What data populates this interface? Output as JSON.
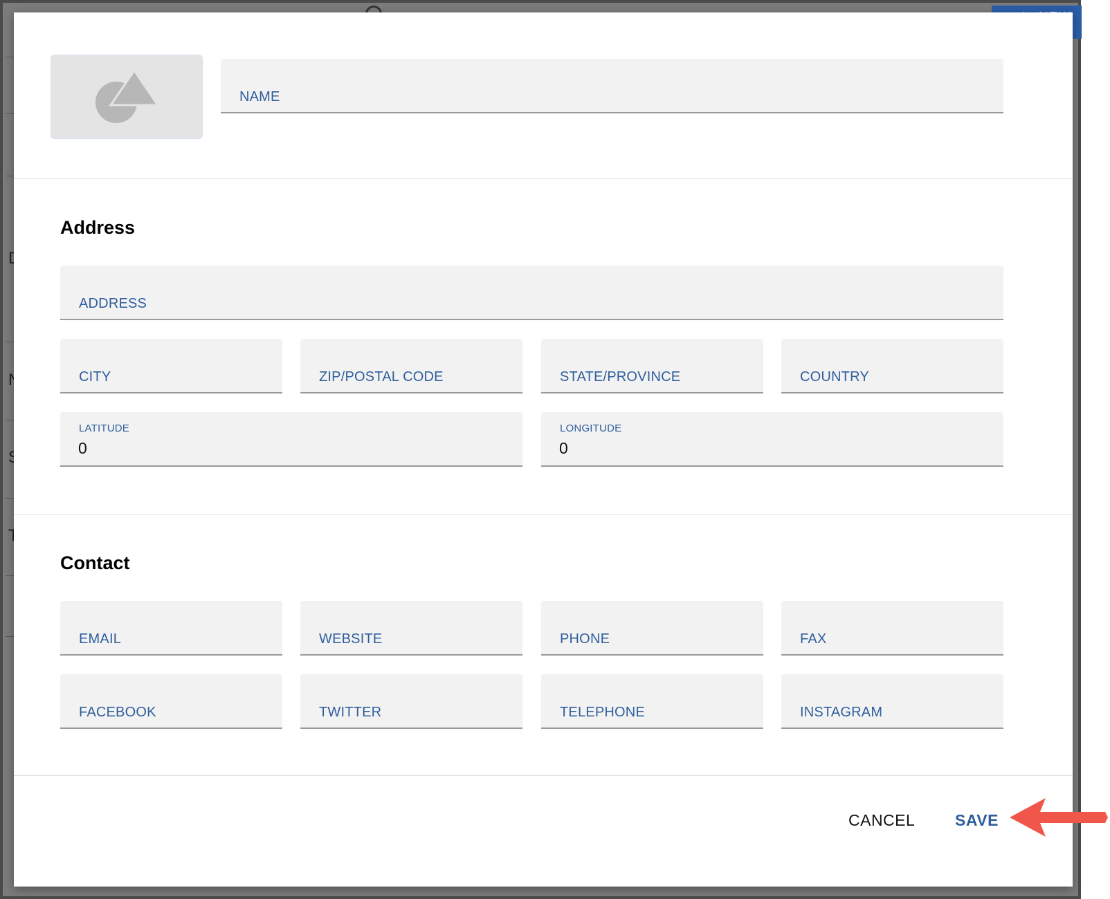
{
  "background": {
    "new_button_label": "NEW",
    "row_letters": [
      "D",
      "N",
      "S",
      "T"
    ]
  },
  "form": {
    "name_label": "NAME",
    "address_section": {
      "title": "Address",
      "address_label": "ADDRESS",
      "city_label": "CITY",
      "zip_label": "ZIP/POSTAL CODE",
      "state_label": "STATE/PROVINCE",
      "country_label": "COUNTRY",
      "latitude_label": "LATITUDE",
      "latitude_value": "0",
      "longitude_label": "LONGITUDE",
      "longitude_value": "0"
    },
    "contact_section": {
      "title": "Contact",
      "email_label": "EMAIL",
      "website_label": "WEBSITE",
      "phone_label": "PHONE",
      "fax_label": "FAX",
      "facebook_label": "FACEBOOK",
      "twitter_label": "TWITTER",
      "telephone_label": "TELEPHONE",
      "instagram_label": "INSTAGRAM"
    }
  },
  "actions": {
    "cancel_label": "CANCEL",
    "save_label": "SAVE"
  },
  "colors": {
    "accent": "#2f5e9c",
    "field_bg": "#f2f2f2",
    "annotation_arrow": "#f0574a"
  },
  "icons": {
    "image_placeholder": "shapes-icon",
    "annotation": "arrow-left-icon"
  }
}
